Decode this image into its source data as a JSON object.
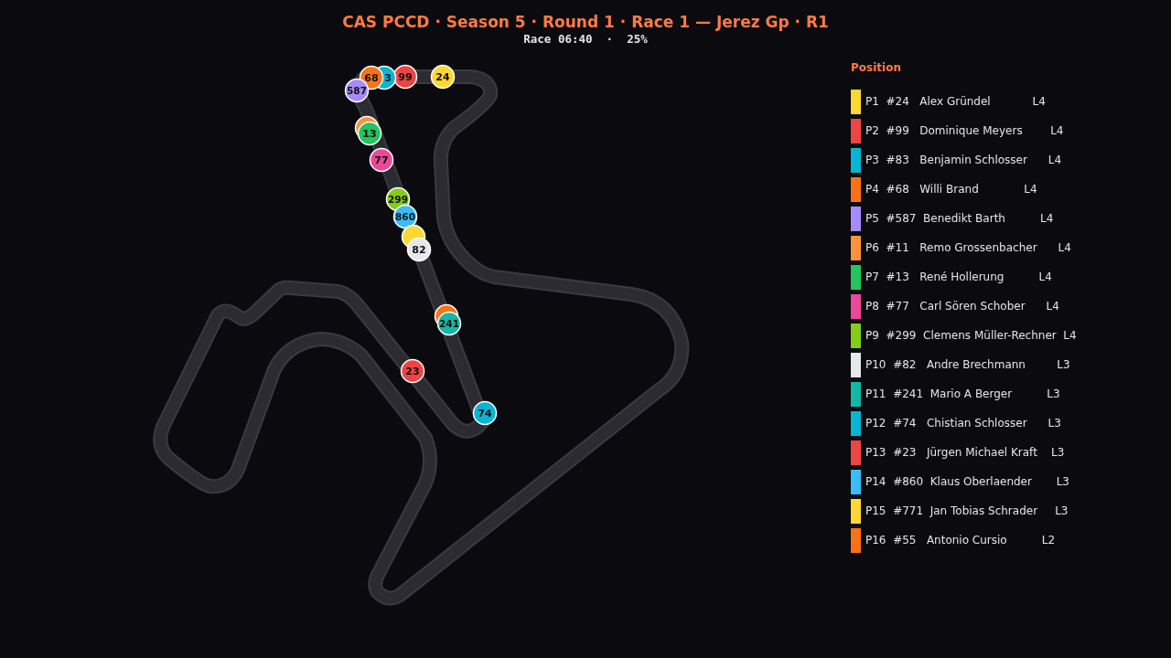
{
  "header": {
    "title": "CAS PCCD · Season 5 · Round 1 · Race 1 — Jerez Gp · R1",
    "status": "Race 06:40  ·  25%"
  },
  "markers": [
    {
      "label": "68",
      "color": "#f97316"
    },
    {
      "label": "3",
      "color": "#06b6d4"
    },
    {
      "label": "99",
      "color": "#ef4444"
    },
    {
      "label": "24",
      "color": "#fdd835"
    },
    {
      "label": "587",
      "color": "#a78bfa"
    },
    {
      "color": "#fb923c"
    },
    {
      "label": "13",
      "color": "#22c55e"
    },
    {
      "label": "77",
      "color": "#ec4899"
    },
    {
      "label": "299",
      "color": "#84cc16"
    },
    {
      "label": "860",
      "color": "#38bdf8"
    },
    {
      "color": "#fdd835"
    },
    {
      "label": "82",
      "color": "#e5e7eb"
    },
    {
      "color": "#f97316"
    },
    {
      "label": "241",
      "color": "#14b8a6"
    },
    {
      "label": "23",
      "color": "#ef4444"
    },
    {
      "label": "74",
      "color": "#06b6d4"
    }
  ],
  "standings": {
    "title": "Position",
    "rows": [
      {
        "text": "P1  #24   Alex Gründel            L4",
        "color": "#fdd835"
      },
      {
        "text": "P2  #99   Dominique Meyers        L4",
        "color": "#ef4444"
      },
      {
        "text": "P3  #83   Benjamin Schlosser      L4",
        "color": "#06b6d4"
      },
      {
        "text": "P4  #68   Willi Brand             L4",
        "color": "#f97316"
      },
      {
        "text": "P5  #587  Benedikt Barth          L4",
        "color": "#a78bfa"
      },
      {
        "text": "P6  #11   Remo Grossenbacher      L4",
        "color": "#fb923c"
      },
      {
        "text": "P7  #13   René Hollerung          L4",
        "color": "#22c55e"
      },
      {
        "text": "P8  #77   Carl Sören Schober      L4",
        "color": "#ec4899"
      },
      {
        "text": "P9  #299  Clemens Müller-Rechner  L4",
        "color": "#84cc16"
      },
      {
        "text": "P10  #82   Andre Brechmann         L3",
        "color": "#e5e7eb"
      },
      {
        "text": "P11  #241  Mario A Berger          L3",
        "color": "#14b8a6"
      },
      {
        "text": "P12  #74   Chistian Schlosser      L3",
        "color": "#06b6d4"
      },
      {
        "text": "P13  #23   Jürgen Michael Kraft    L3",
        "color": "#ef4444"
      },
      {
        "text": "P14  #860  Klaus Oberlaender       L3",
        "color": "#38bdf8"
      },
      {
        "text": "P15  #771  Jan Tobias Schrader     L3",
        "color": "#fdd835"
      },
      {
        "text": "P16  #55   Antonio Cursio          L2",
        "color": "#f97316"
      }
    ]
  }
}
